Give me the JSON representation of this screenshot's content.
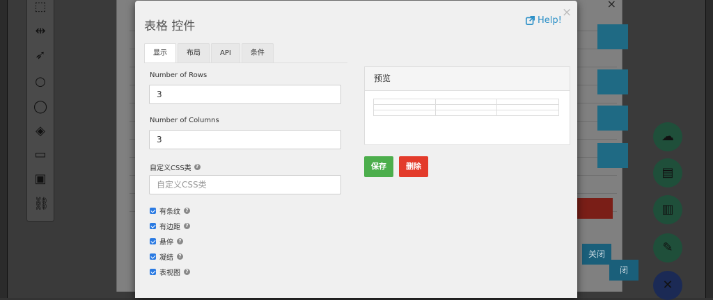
{
  "modal": {
    "title": "表格 控件",
    "help_label": "Help!",
    "close_glyph": "×"
  },
  "tabs": [
    {
      "label": "显示",
      "active": true
    },
    {
      "label": "布局",
      "active": false
    },
    {
      "label": "API",
      "active": false
    },
    {
      "label": "条件",
      "active": false
    }
  ],
  "form": {
    "rows": {
      "label": "Number of Rows",
      "value": "3"
    },
    "columns": {
      "label": "Number of Columns",
      "value": "3"
    },
    "css_class": {
      "label": "自定义CSS类",
      "placeholder": "自定义CSS类",
      "value": ""
    }
  },
  "options": [
    {
      "label": "有条纹",
      "checked": true
    },
    {
      "label": "有边距",
      "checked": true
    },
    {
      "label": "悬停",
      "checked": true
    },
    {
      "label": "凝结",
      "checked": true
    },
    {
      "label": "表视图",
      "checked": true
    }
  ],
  "preview": {
    "title": "预览",
    "rows": 3,
    "columns": 3
  },
  "actions": {
    "save_label": "保存",
    "delete_label": "删除"
  },
  "background": {
    "close_button_label": "关闭",
    "close_button_partial": "闭",
    "back_close_glyph": "×"
  },
  "colors": {
    "accent": "#2a8fc7",
    "save": "#4cae4c",
    "delete": "#e33b2b",
    "checkbox": "#2a7ae2"
  }
}
